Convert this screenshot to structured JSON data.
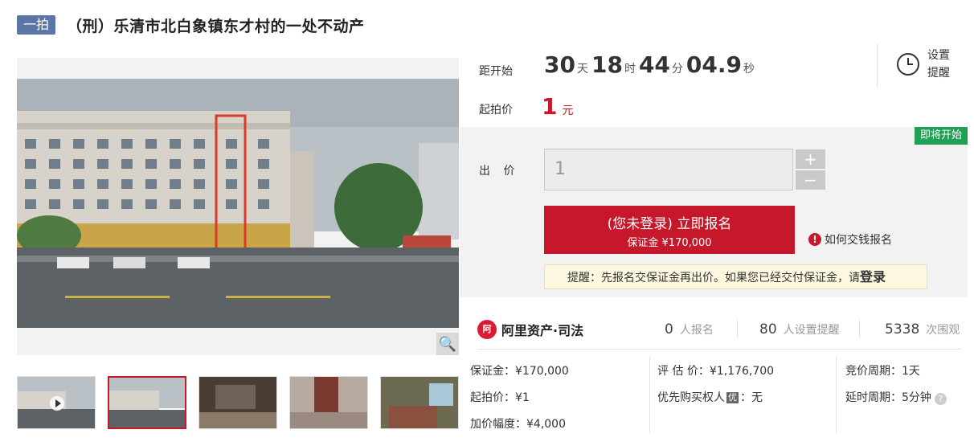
{
  "header": {
    "badge": "一拍",
    "title": "（刑）乐清市北白象镇东才村的一处不动产"
  },
  "countdown": {
    "label": "距开始",
    "days": "30",
    "days_unit": "天",
    "hours": "18",
    "hours_unit": "时",
    "minutes": "44",
    "minutes_unit": "分",
    "seconds": "04.9",
    "seconds_unit": "秒"
  },
  "reminder": {
    "label": "设置提醒",
    "icon": "alarm-clock-icon"
  },
  "start_price": {
    "label": "起拍价",
    "value": "1",
    "unit": "元"
  },
  "bid": {
    "status_tag": "即将开始",
    "label": "出 价",
    "value": "1",
    "plus": "+",
    "minus": "−",
    "signup_label": "(您未登录) 立即报名",
    "deposit_label": "保证金 ¥170,000",
    "howto_label": "如何交钱报名",
    "notice_text": "提醒：先报名交保证金再出价。如果您已经交付保证金，请",
    "notice_login": "登录"
  },
  "brand": {
    "logo": "阿",
    "name": "阿里资产·司法"
  },
  "stats": [
    {
      "count": "0",
      "text": "人报名"
    },
    {
      "count": "80",
      "text": "人设置提醒"
    },
    {
      "count": "5338",
      "text": "次围观"
    }
  ],
  "details": {
    "deposit": "保证金：¥170,000",
    "start_price": "起拍价：¥1",
    "increment": "加价幅度：¥4,000",
    "appraisal": "评 估 价：¥1,176,700",
    "priority_label": "优先购买权人",
    "priority_badge": "优",
    "priority_value": "：无",
    "cycle": "竞价周期：1天",
    "delay": "延时周期：5分钟",
    "help": "?"
  },
  "colors": {
    "accent": "#c7172b",
    "badge": "#5b76a6",
    "status_green": "#1fa055"
  }
}
